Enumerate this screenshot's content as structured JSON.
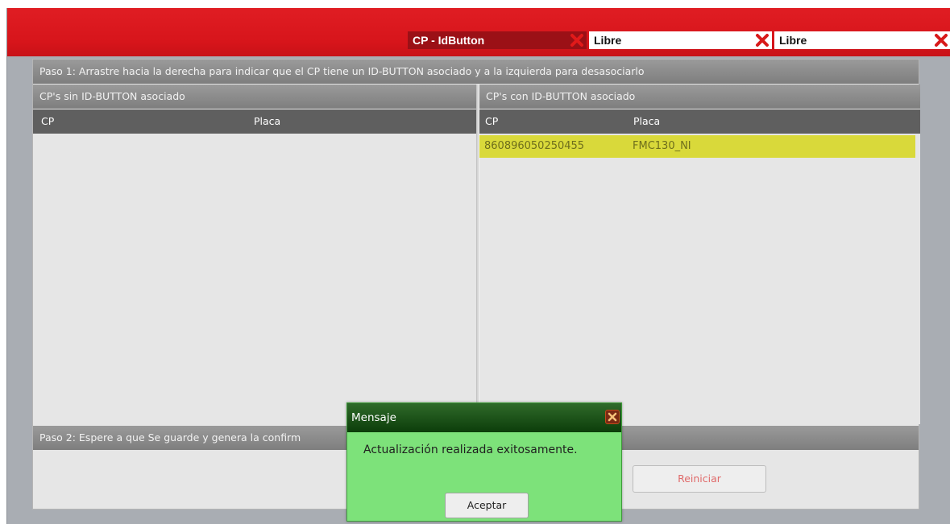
{
  "tabs": [
    {
      "label": "CP - IdButton"
    },
    {
      "label": "Libre"
    },
    {
      "label": "Libre"
    }
  ],
  "step1": "Paso 1: Arrastre hacia la derecha para indicar que el CP tiene un ID-BUTTON asociado y a la izquierda para desasociarlo",
  "left_panel": {
    "title": "CP's sin ID-BUTTON asociado",
    "columns": [
      "CP",
      "Placa"
    ],
    "rows": []
  },
  "right_panel": {
    "title": "CP's con ID-BUTTON asociado",
    "columns": [
      "CP",
      "Placa"
    ],
    "rows": [
      {
        "cp": "860896050250455",
        "placa": "FMC130_NI"
      }
    ]
  },
  "step2": "Paso 2: Espere a que Se guarde y genera la confirm",
  "reset_button": "Reiniciar",
  "dialog": {
    "title": "Mensaje",
    "message": "Actualización realizada exitosamente.",
    "ok_button": "Aceptar"
  },
  "colors": {
    "brand_red": "#d7151b",
    "active_tab": "#9b1016",
    "highlight_row": "#d9d93a",
    "dialog_bg": "#7de27a"
  },
  "icons": [
    "close-icon"
  ]
}
